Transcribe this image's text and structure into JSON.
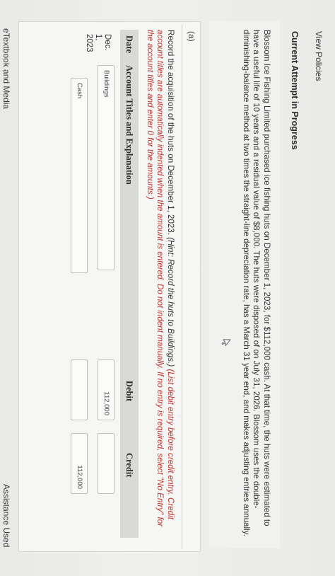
{
  "links": {
    "view_policies": "View Policies",
    "etextbook": "eTextbook and Media",
    "assistance_used": "Assistance Used"
  },
  "attempt": {
    "heading": "Current Attempt in Progress"
  },
  "problem": {
    "text": "Blossom Ice Fishing Limited purchased ice fishing huts on December 1, 2023, for $112,000 cash. At that time, the huts were estimated to have a useful life of 10 years and a residual value of $8,000. The huts were disposed of on July 31, 2026. Blossom uses the double-diminishing-balance method at two times the straight-line depreciation rate, has a March 31 year end, and makes adjusting entries annually."
  },
  "part_a": {
    "label": "(a)",
    "instruction_plain": "Record the acquisition of the huts on December 1, 2023.",
    "instruction_hint": " (Hint: Record the huts to Buildings.)",
    "instruction_red": " (List debit entry before credit entry. Credit account titles are automatically indented when the amount is entered. Do not indent manually. If no entry is required, select \"No Entry\" for the account titles and enter 0 for the amounts.)"
  },
  "table": {
    "headers": {
      "date": "Date",
      "account": "Account Titles and Explanation",
      "debit": "Debit",
      "credit": "Credit"
    },
    "rows": [
      {
        "date": "Dec. 1, 2023",
        "account": "Buildings",
        "debit": "112,000",
        "credit": ""
      },
      {
        "date": "",
        "account": "Cash",
        "debit": "",
        "credit": "112,000"
      }
    ]
  },
  "icons": {
    "pointer": "mouse-pointer-icon"
  }
}
